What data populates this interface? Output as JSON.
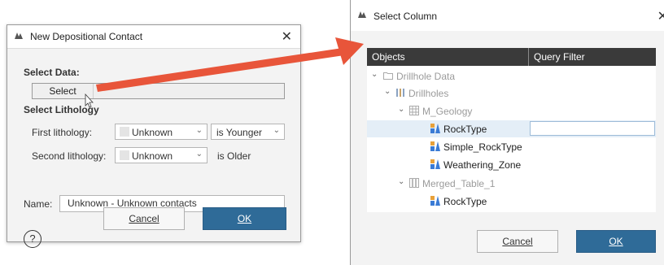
{
  "left_dialog": {
    "title": "New Depositional Contact",
    "close_glyph": "✕",
    "select_data_label": "Select Data:",
    "select_button_label": "Select",
    "select_lithology_label": "Select Lithology",
    "first_lithology_label": "First lithology:",
    "first_lithology_value": "Unknown",
    "relation_value": "is Younger",
    "second_lithology_label": "Second lithology:",
    "second_lithology_value": "Unknown",
    "second_relation_text": "is Older",
    "name_label": "Name:",
    "name_value": "Unknown - Unknown contacts",
    "help_glyph": "?",
    "cancel_label": "Cancel",
    "ok_label": "OK"
  },
  "right_dialog": {
    "title": "Select Column",
    "close_glyph": "✕",
    "columns": [
      "Objects",
      "Query Filter"
    ],
    "tree": [
      {
        "label": "Drillhole Data",
        "icon": "folder-icon",
        "muted": true
      },
      {
        "label": "Drillholes",
        "icon": "drillholes-icon",
        "muted": true
      },
      {
        "label": "M_Geology",
        "icon": "table-icon",
        "muted": true
      },
      {
        "label": "RockType",
        "icon": "lithology-column-icon",
        "muted": false,
        "selected": true
      },
      {
        "label": "Simple_RockType",
        "icon": "lithology-column-icon",
        "muted": false
      },
      {
        "label": "Weathering_Zone",
        "icon": "lithology-column-icon",
        "muted": false
      },
      {
        "label": "Merged_Table_1",
        "icon": "merged-table-icon",
        "muted": true
      },
      {
        "label": "RockType",
        "icon": "lithology-column-icon",
        "muted": false
      }
    ],
    "cancel_label": "Cancel",
    "ok_label": "OK"
  },
  "colors": {
    "accent": "#2f6b98",
    "arrow": "#e8553a",
    "header_bg": "#3a3a3a",
    "selection": "#e4eef7"
  }
}
